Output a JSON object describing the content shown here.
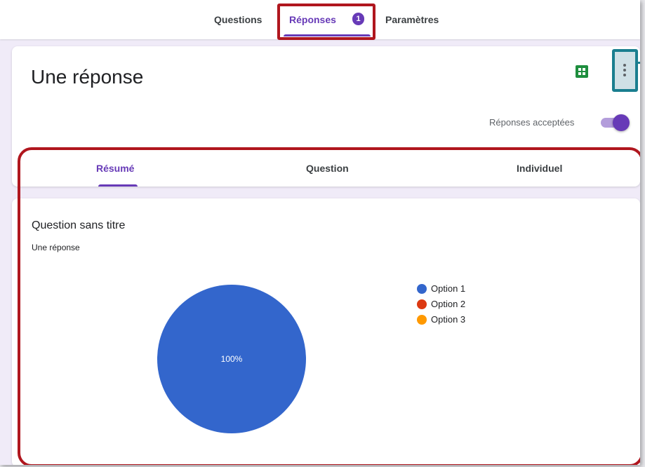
{
  "top_tabs": {
    "questions": "Questions",
    "responses": "Réponses",
    "responses_count": "1",
    "settings": "Paramètres"
  },
  "summary": {
    "title": "Une réponse",
    "accepting_label": "Réponses acceptées",
    "accepting": true
  },
  "sub_tabs": {
    "summary": "Résumé",
    "question": "Question",
    "individual": "Individuel"
  },
  "question": {
    "title": "Question sans titre",
    "response_count": "Une réponse"
  },
  "chart_data": {
    "type": "pie",
    "labels": [
      "Option 1",
      "Option 2",
      "Option 3"
    ],
    "values": [
      100,
      0,
      0
    ],
    "data_labels": [
      "100%",
      "",
      ""
    ],
    "colors": [
      "#3366cc",
      "#dc3912",
      "#ff9900"
    ],
    "legend": "right"
  },
  "colors": {
    "accent": "#673ab7",
    "highlight_red": "#b0161e",
    "highlight_teal": "#1a7e8f",
    "sheets_green": "#1e8e3e"
  },
  "icons": {
    "sheets": "sheets-icon",
    "more": "more-vert-icon"
  }
}
